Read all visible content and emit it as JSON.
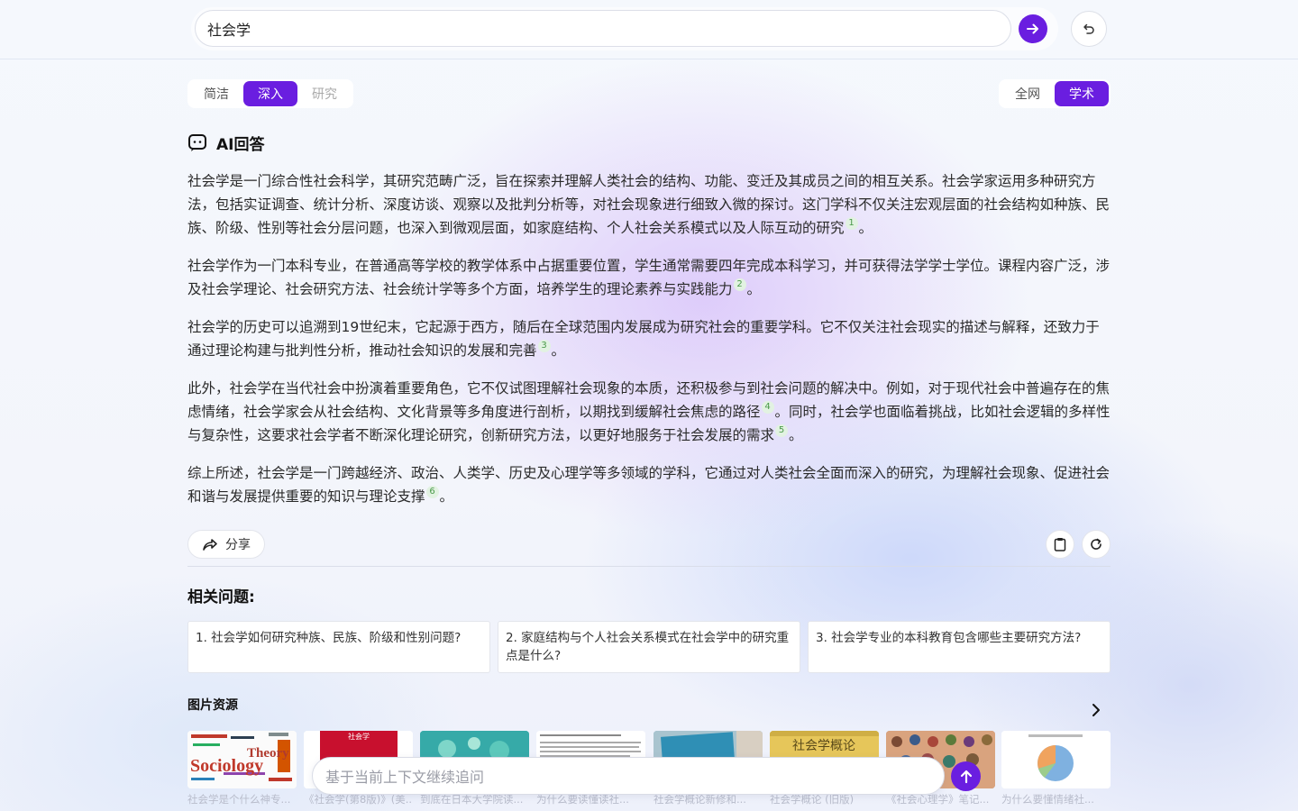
{
  "colors": {
    "accent": "#6a1ee0",
    "citation_bg": "#e2f2e2",
    "citation_text": "#4a9a4a"
  },
  "search": {
    "query": "社会学",
    "go_icon": "arrow-right-icon",
    "reset_icon": "undo-icon"
  },
  "depth_modes": {
    "items": [
      "简洁",
      "深入",
      "研究"
    ],
    "selected": "深入",
    "disabled": "研究"
  },
  "source_modes": {
    "items": [
      "全网",
      "学术"
    ],
    "selected": "学术"
  },
  "answer": {
    "title": "AI回答",
    "paragraphs": [
      {
        "segments": [
          {
            "text": "社会学是一门综合性社会科学，其研究范畴广泛，旨在探索并理解人类社会的结构、功能、变迁及其成员之间的相互关系。社会学家运用多种研究方法，包括实证调查、统计分析、深度访谈、观察以及批判分析等，对社会现象进行细致入微的探讨。这门学科不仅关注宏观层面的社会结构如种族、民族、阶级、性别等社会分层问题，也深入到微观层面，如家庭结构、个人社会关系模式以及人际互动的研究",
            "cite": "1"
          }
        ],
        "end": "。"
      },
      {
        "segments": [
          {
            "text": "社会学作为一门本科专业，在普通高等学校的教学体系中占据重要位置，学生通常需要四年完成本科学习，并可获得法学学士学位。课程内容广泛，涉及社会学理论、社会研究方法、社会统计学等多个方面，培养学生的理论素养与实践能力",
            "cite": "2"
          }
        ],
        "end": "。"
      },
      {
        "segments": [
          {
            "text": "社会学的历史可以追溯到19世纪末，它起源于西方，随后在全球范围内发展成为研究社会的重要学科。它不仅关注社会现实的描述与解释，还致力于通过理论构建与批判性分析，推动社会知识的发展和完善",
            "cite": "3"
          }
        ],
        "end": "。"
      },
      {
        "segments": [
          {
            "text": "此外，社会学在当代社会中扮演着重要角色，它不仅试图理解社会现象的本质，还积极参与到社会问题的解决中。例如，对于现代社会中普遍存在的焦虑情绪，社会学家会从社会结构、文化背景等多角度进行剖析，以期找到缓解社会焦虑的路径",
            "cite": "4"
          },
          {
            "text": "。同时，社会学也面临着挑战，比如社会逻辑的多样性与复杂性，这要求社会学者不断深化理论研究，创新研究方法，以更好地服务于社会发展的需求",
            "cite": "5"
          }
        ],
        "end": "。"
      },
      {
        "segments": [
          {
            "text": "综上所述，社会学是一门跨越经济、政治、人类学、历史及心理学等多领域的学科，它通过对人类社会全面而深入的研究，为理解社会现象、促进社会和谐与发展提供重要的知识与理论支撑",
            "cite": "6"
          }
        ],
        "end": "。"
      }
    ]
  },
  "actions": {
    "share_label": "分享",
    "share_icon": "share-icon",
    "copy_icon": "clipboard-icon",
    "regenerate_icon": "refresh-icon"
  },
  "related": {
    "title": "相关问题:",
    "questions": [
      "1. 社会学如何研究种族、民族、阶级和性别问题?",
      "2. 家庭结构与个人社会关系模式在社会学中的研究重点是什么?",
      "3. 社会学专业的本科教育包含哪些主要研究方法?"
    ]
  },
  "images": {
    "title": "图片资源",
    "next_icon": "chevron-right-icon",
    "items": [
      {
        "caption": "社会学是个什么神专...",
        "overlay_text": "Sociology",
        "overlay_text2": "Theory"
      },
      {
        "caption": "《社会学(第8版)》(美...",
        "overlay_text": "社会学"
      },
      {
        "caption": "到底在日本大学院读...",
        "overlay_text": ""
      },
      {
        "caption": "为什么要读懂读社...",
        "overlay_text": ""
      },
      {
        "caption": "社会学概论新修和...",
        "overlay_text": ""
      },
      {
        "caption": "社会学概论 (旧版)",
        "overlay_text": "社会学概论"
      },
      {
        "caption": "《社会心理学》笔记...",
        "overlay_text": ""
      },
      {
        "caption": "为什么要懂情绪社...",
        "overlay_text": ""
      }
    ]
  },
  "followup": {
    "placeholder": "基于当前上下文继续追问",
    "send_icon": "arrow-up-icon"
  }
}
